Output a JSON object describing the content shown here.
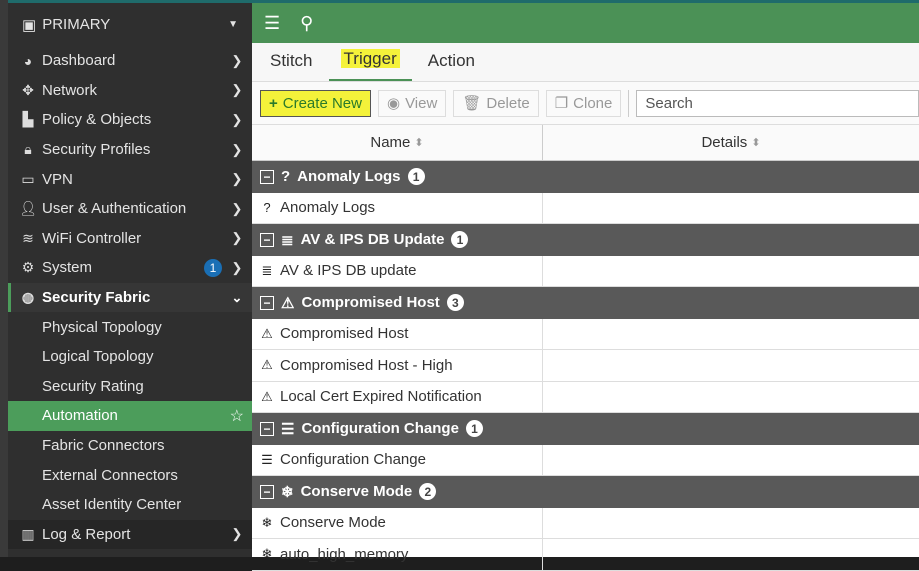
{
  "sidebar": {
    "title": "PRIMARY",
    "items": [
      {
        "label": "Dashboard",
        "icon": "dashboard-icon",
        "glyph": "◕"
      },
      {
        "label": "Network",
        "icon": "network-icon",
        "glyph": "✥"
      },
      {
        "label": "Policy & Objects",
        "icon": "policy-icon",
        "glyph": "▙"
      },
      {
        "label": "Security Profiles",
        "icon": "lock-icon",
        "glyph": "🔒︎"
      },
      {
        "label": "VPN",
        "icon": "laptop-icon",
        "glyph": "▭"
      },
      {
        "label": "User & Authentication",
        "icon": "user-icon",
        "glyph": "👤︎"
      },
      {
        "label": "WiFi Controller",
        "icon": "wifi-icon",
        "glyph": "≋"
      },
      {
        "label": "System",
        "icon": "gear-icon",
        "glyph": "⚙",
        "badge": "1"
      }
    ],
    "open": {
      "label": "Security Fabric",
      "icon": "security-fabric-icon",
      "glyph": "◍",
      "subitems": [
        "Physical Topology",
        "Logical Topology",
        "Security Rating",
        "Automation",
        "Fabric Connectors",
        "External Connectors",
        "Asset Identity Center"
      ],
      "active": "Automation"
    },
    "log": {
      "label": "Log & Report",
      "icon": "chart-icon",
      "glyph": "▥"
    }
  },
  "tabs": [
    "Stitch",
    "Trigger",
    "Action"
  ],
  "active_tab": "Trigger",
  "toolbar": {
    "create": "Create New",
    "view": "View",
    "delete": "Delete",
    "clone": "Clone",
    "search_placeholder": "Search"
  },
  "table": {
    "columns": [
      "Name",
      "Details"
    ],
    "groups": [
      {
        "name": "Anomaly Logs",
        "count": "1",
        "glyph": "?",
        "rows": [
          "Anomaly Logs"
        ]
      },
      {
        "name": "AV & IPS DB Update",
        "count": "1",
        "glyph": "≣",
        "rows": [
          "AV & IPS DB update"
        ]
      },
      {
        "name": "Compromised Host",
        "count": "3",
        "glyph": "⚠",
        "rows": [
          "Compromised Host",
          "Compromised Host - High",
          "Local Cert Expired Notification"
        ]
      },
      {
        "name": "Configuration Change",
        "count": "1",
        "glyph": "☰",
        "rows": [
          "Configuration Change"
        ]
      },
      {
        "name": "Conserve Mode",
        "count": "2",
        "glyph": "❄",
        "rows": [
          "Conserve Mode",
          "auto_high_memory"
        ]
      }
    ]
  },
  "colors": {
    "accent": "#4b9156",
    "highlight": "#f4f23a",
    "group_row": "#595959"
  }
}
